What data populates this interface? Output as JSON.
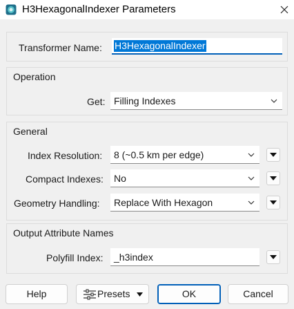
{
  "window": {
    "title": "H3HexagonalIndexer Parameters",
    "icon": "h3-transformer-icon",
    "close_icon": "close-icon"
  },
  "transformer_name": {
    "label": "Transformer Name:",
    "value": "H3HexagonalIndexer"
  },
  "operation": {
    "title": "Operation",
    "get": {
      "label": "Get:",
      "value": "Filling Indexes"
    }
  },
  "general": {
    "title": "General",
    "index_resolution": {
      "label": "Index Resolution:",
      "value": "8 (~0.5 km per edge)"
    },
    "compact_indexes": {
      "label": "Compact Indexes:",
      "value": "No"
    },
    "geometry_handling": {
      "label": "Geometry Handling:",
      "value": "Replace With Hexagon"
    }
  },
  "output_attribute_names": {
    "title": "Output Attribute Names",
    "polyfill_index": {
      "label": "Polyfill Index:",
      "value": "_h3index"
    }
  },
  "buttons": {
    "help": "Help",
    "presets": "Presets",
    "ok": "OK",
    "cancel": "Cancel"
  },
  "colors": {
    "accent": "#005fb8",
    "selection": "#0078d7",
    "background": "#f0f0f0"
  }
}
